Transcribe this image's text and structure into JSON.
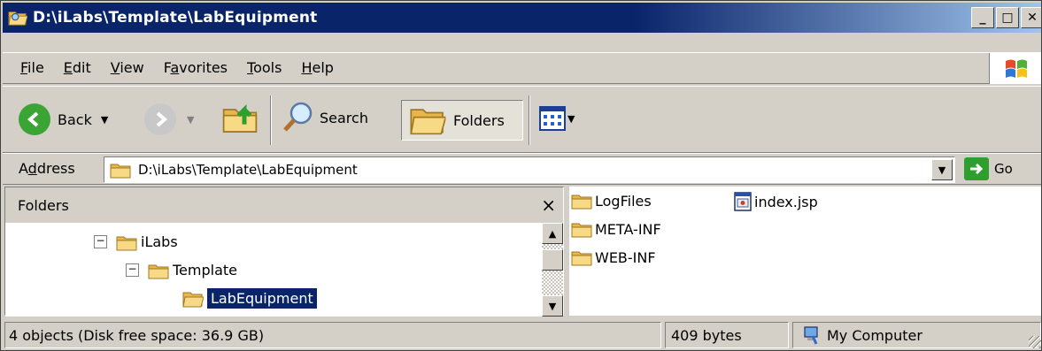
{
  "window": {
    "title": "D:\\iLabs\\Template\\LabEquipment",
    "buttons": [
      "_",
      "□",
      "✕"
    ]
  },
  "menubar": {
    "items": [
      {
        "label": "File",
        "accel": "F",
        "rest": "ile"
      },
      {
        "label": "Edit",
        "accel": "E",
        "rest": "dit"
      },
      {
        "label": "View",
        "accel": "V",
        "rest": "iew"
      },
      {
        "label": "Favorites",
        "accel": "a",
        "pre": "F",
        "rest": "vorites"
      },
      {
        "label": "Tools",
        "accel": "T",
        "rest": "ools"
      },
      {
        "label": "Help",
        "accel": "H",
        "rest": "elp"
      }
    ]
  },
  "toolbar": {
    "back_label": "Back",
    "search_label": "Search",
    "folders_label": "Folders"
  },
  "address": {
    "label_pre": "A",
    "label_accel": "d",
    "label_rest": "dress",
    "path": "D:\\iLabs\\Template\\LabEquipment",
    "go_label": "Go"
  },
  "folders_pane": {
    "title": "Folders",
    "close": "×",
    "tree": [
      {
        "label": "iLabs",
        "expander": "−"
      },
      {
        "label": "Template",
        "expander": "−"
      },
      {
        "label": "LabEquipment",
        "selected": true
      }
    ]
  },
  "files": [
    {
      "name": "LogFiles",
      "icon": "folder-icon"
    },
    {
      "name": "META-INF",
      "icon": "folder-icon"
    },
    {
      "name": "WEB-INF",
      "icon": "folder-icon"
    },
    {
      "name": "index.jsp",
      "icon": "jsp-file-icon"
    }
  ],
  "status": {
    "objects": "4 objects (Disk free space: 36.9 GB)",
    "size": "409 bytes",
    "location": "My Computer"
  },
  "colors": {
    "titlebar": "#0a246a",
    "selection": "#0a246a",
    "face": "#d4d0c8",
    "folder": "#f5d37a"
  }
}
